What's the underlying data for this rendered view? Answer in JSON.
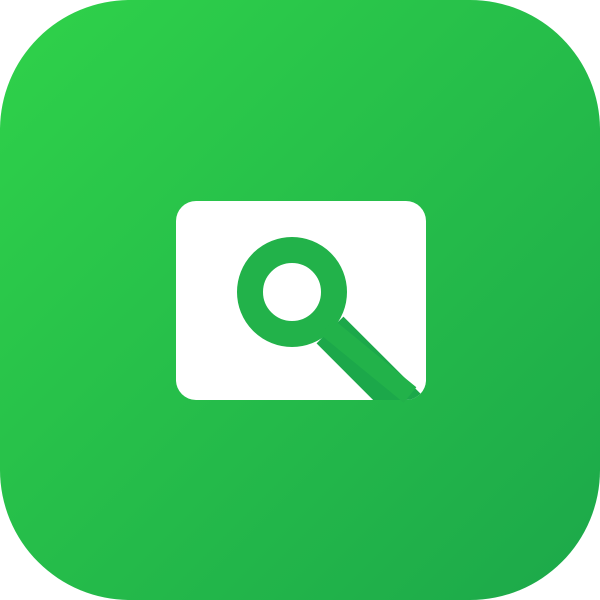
{
  "app_icon": {
    "icon": "image-search-icon",
    "colors": {
      "gradient_start": "#2fd24a",
      "gradient_end": "#1ca84a",
      "card": "#ffffff",
      "magnifier": "#22b24a"
    }
  }
}
